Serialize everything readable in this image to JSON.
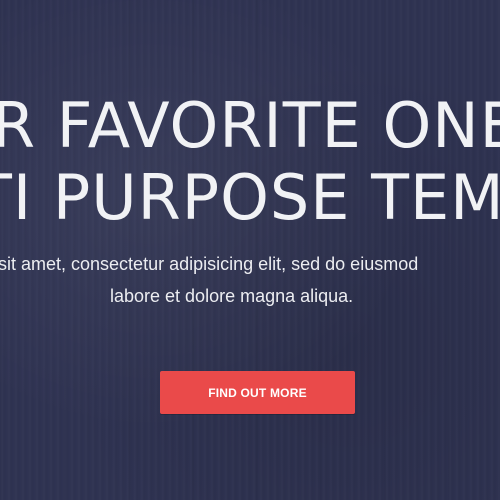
{
  "hero": {
    "headline_line1": "R FAVORITE ONE P",
    "headline_line2": "TI PURPOSE TEMP",
    "subtext_line1": "sit amet, consectetur adipisicing elit, sed do eiusmod",
    "subtext_line2": "labore et dolore magna aliqua.",
    "cta_label": "FIND OUT MORE"
  },
  "colors": {
    "background": "#2f3352",
    "text": "#f1f2f5",
    "cta_background": "#ea4a4a",
    "cta_text": "#ffffff"
  }
}
